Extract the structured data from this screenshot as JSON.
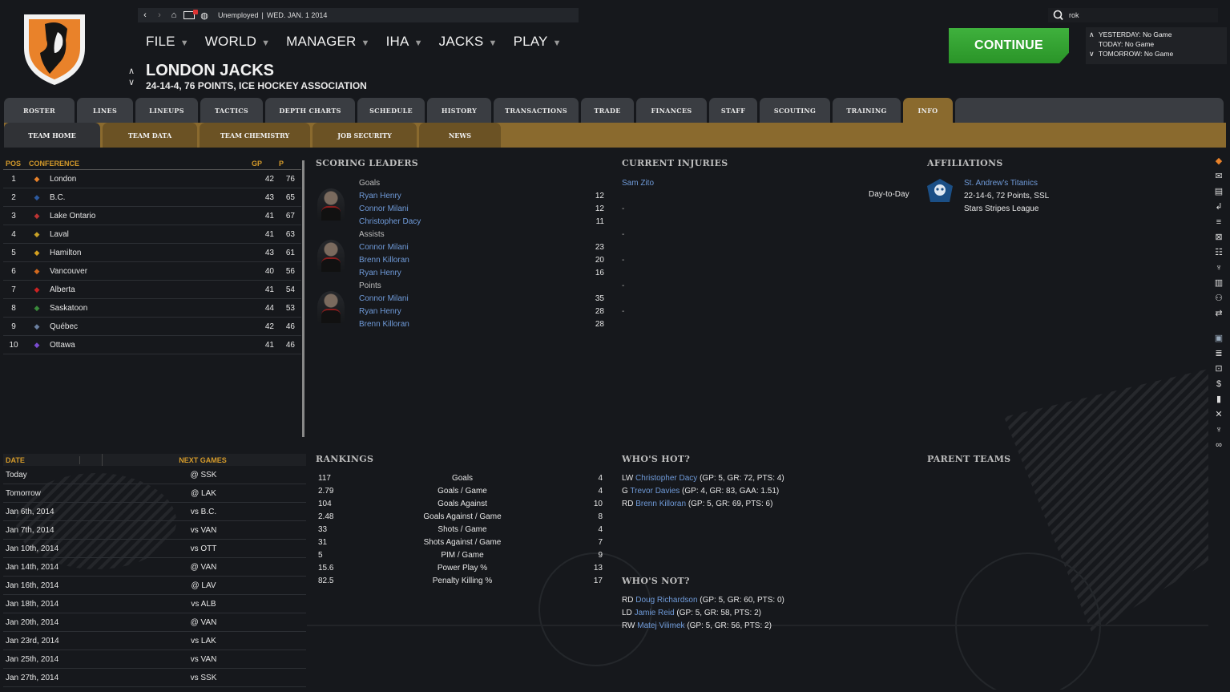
{
  "topbar": {
    "status": "Unemployed",
    "date": "WED. JAN. 1 2014"
  },
  "menu": [
    "FILE",
    "WORLD",
    "MANAGER",
    "IHA",
    "JACKS",
    "PLAY"
  ],
  "team": {
    "name": "LONDON JACKS",
    "subtitle": "24-14-4, 76 POINTS, ICE HOCKEY ASSOCIATION"
  },
  "search": {
    "value": "rok"
  },
  "continue_label": "CONTINUE",
  "days": {
    "yesterday": "YESTERDAY: No Game",
    "today": "TODAY: No Game",
    "tomorrow": "TOMORROW: No Game"
  },
  "tabs": [
    "ROSTER",
    "LINES",
    "LINEUPS",
    "TACTICS",
    "DEPTH CHARTS",
    "SCHEDULE",
    "HISTORY",
    "TRANSACTIONS",
    "TRADE",
    "FINANCES",
    "STAFF",
    "SCOUTING",
    "TRAINING",
    "INFO"
  ],
  "subtabs": [
    "TEAM HOME",
    "TEAM DATA",
    "TEAM CHEMISTRY",
    "JOB SECURITY",
    "NEWS"
  ],
  "standings": {
    "headers": {
      "pos": "POS",
      "conf": "CONFERENCE",
      "gp": "GP",
      "p": "P"
    },
    "rows": [
      {
        "pos": "1",
        "team": "London",
        "gp": "42",
        "p": "76"
      },
      {
        "pos": "2",
        "team": "B.C.",
        "gp": "43",
        "p": "65"
      },
      {
        "pos": "3",
        "team": "Lake Ontario",
        "gp": "41",
        "p": "67"
      },
      {
        "pos": "4",
        "team": "Laval",
        "gp": "41",
        "p": "63"
      },
      {
        "pos": "5",
        "team": "Hamilton",
        "gp": "43",
        "p": "61"
      },
      {
        "pos": "6",
        "team": "Vancouver",
        "gp": "40",
        "p": "56"
      },
      {
        "pos": "7",
        "team": "Alberta",
        "gp": "41",
        "p": "54"
      },
      {
        "pos": "8",
        "team": "Saskatoon",
        "gp": "44",
        "p": "53"
      },
      {
        "pos": "9",
        "team": "Québec",
        "gp": "42",
        "p": "46"
      },
      {
        "pos": "10",
        "team": "Ottawa",
        "gp": "41",
        "p": "46"
      }
    ]
  },
  "games": {
    "headers": {
      "date": "DATE",
      "next": "NEXT GAMES"
    },
    "rows": [
      {
        "date": "Today",
        "opp": "@ SSK"
      },
      {
        "date": "Tomorrow",
        "opp": "@ LAK"
      },
      {
        "date": "Jan 6th, 2014",
        "opp": "vs B.C."
      },
      {
        "date": "Jan 7th, 2014",
        "opp": "vs VAN"
      },
      {
        "date": "Jan 10th, 2014",
        "opp": "vs OTT"
      },
      {
        "date": "Jan 14th, 2014",
        "opp": "@ VAN"
      },
      {
        "date": "Jan 16th, 2014",
        "opp": "@ LAV"
      },
      {
        "date": "Jan 18th, 2014",
        "opp": "vs ALB"
      },
      {
        "date": "Jan 20th, 2014",
        "opp": "@ VAN"
      },
      {
        "date": "Jan 23rd, 2014",
        "opp": "vs LAK"
      },
      {
        "date": "Jan 25th, 2014",
        "opp": "vs VAN"
      },
      {
        "date": "Jan 27th, 2014",
        "opp": "vs SSK"
      }
    ]
  },
  "scoring": {
    "title": "SCORING LEADERS",
    "groups": [
      {
        "label": "Goals",
        "players": [
          {
            "name": "Ryan Henry",
            "val": "12"
          },
          {
            "name": "Connor Milani",
            "val": "12"
          },
          {
            "name": "Christopher Dacy",
            "val": "11"
          }
        ]
      },
      {
        "label": "Assists",
        "players": [
          {
            "name": "Connor Milani",
            "val": "23"
          },
          {
            "name": "Brenn Killoran",
            "val": "20"
          },
          {
            "name": "Ryan Henry",
            "val": "16"
          }
        ]
      },
      {
        "label": "Points",
        "players": [
          {
            "name": "Connor Milani",
            "val": "35"
          },
          {
            "name": "Ryan Henry",
            "val": "28"
          },
          {
            "name": "Brenn Killoran",
            "val": "28"
          }
        ]
      }
    ]
  },
  "injuries": {
    "title": "CURRENT INJURIES",
    "player": "Sam Zito",
    "status": "Day-to-Day",
    "dashes": [
      "-",
      "-",
      "-",
      "-",
      "-"
    ]
  },
  "affiliations": {
    "title": "AFFILIATIONS",
    "team": "St. Andrew's Titanics",
    "record": "22-14-6, 72 Points, SSL",
    "league": "Stars Stripes League"
  },
  "rankings": {
    "title": "RANKINGS",
    "rows": [
      {
        "val": "117",
        "stat": "Goals",
        "rank": "4"
      },
      {
        "val": "2.79",
        "stat": "Goals / Game",
        "rank": "4"
      },
      {
        "val": "104",
        "stat": "Goals Against",
        "rank": "10"
      },
      {
        "val": "2.48",
        "stat": "Goals Against / Game",
        "rank": "8"
      },
      {
        "val": "33",
        "stat": "Shots / Game",
        "rank": "4"
      },
      {
        "val": "31",
        "stat": "Shots Against / Game",
        "rank": "7"
      },
      {
        "val": "5",
        "stat": "PIM / Game",
        "rank": "9"
      },
      {
        "val": "15.6",
        "stat": "Power Play %",
        "rank": "13"
      },
      {
        "val": "82.5",
        "stat": "Penalty Killing %",
        "rank": "17"
      }
    ]
  },
  "hot": {
    "title": "WHO'S HOT?",
    "rows": [
      {
        "pos": "LW",
        "name": "Christopher Dacy",
        "stats": "(GP: 5, GR: 72, PTS: 4)"
      },
      {
        "pos": "G",
        "name": "Trevor Davies",
        "stats": "(GP: 4, GR: 83, GAA: 1.51)"
      },
      {
        "pos": "RD",
        "name": "Brenn Killoran",
        "stats": "(GP: 5, GR: 69, PTS: 6)"
      }
    ]
  },
  "not": {
    "title": "WHO'S NOT?",
    "rows": [
      {
        "pos": "RD",
        "name": "Doug Richardson",
        "stats": "(GP: 5, GR: 60, PTS: 0)"
      },
      {
        "pos": "LD",
        "name": "Jamie Reid",
        "stats": "(GP: 5, GR: 58, PTS: 2)"
      },
      {
        "pos": "RW",
        "name": "Matej Vilimek",
        "stats": "(GP: 5, GR: 56, PTS: 2)"
      }
    ]
  },
  "parent": {
    "title": "PARENT TEAMS"
  },
  "colors": {
    "accent": "#8a6a2e",
    "header_text": "#d49a2a",
    "link": "#6f9ad8",
    "continue": "#3fb13d"
  }
}
